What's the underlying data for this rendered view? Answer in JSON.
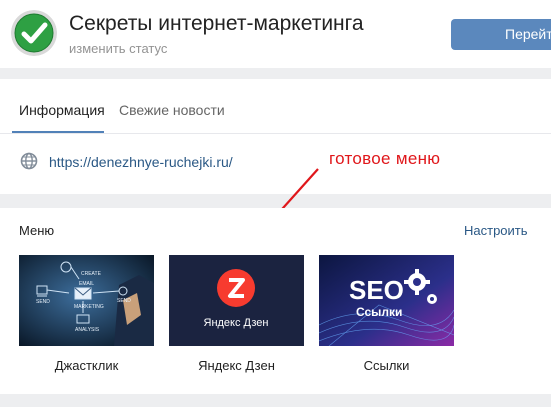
{
  "header": {
    "title": "Секреты интернет-маркетинга",
    "status": "изменить статус",
    "go_button": "Перейти"
  },
  "info": {
    "tabs": [
      {
        "label": "Информация",
        "active": true
      },
      {
        "label": "Свежие новости",
        "active": false
      }
    ],
    "site": "https://denezhnye-ruchejki.ru/",
    "annotation": "готовое меню"
  },
  "menu": {
    "title": "Меню",
    "configure": "Настроить",
    "items": [
      {
        "label": "Джастклик",
        "image_texts": [
          "CREATE",
          "EMAIL",
          "SEND",
          "MARKETING",
          "ANALYSIS"
        ]
      },
      {
        "label": "Яндекс Дзен",
        "image_texts": [
          "Яндекс Дзен"
        ]
      },
      {
        "label": "Ссылки",
        "image_texts": [
          "SEO",
          "Ссылки"
        ]
      }
    ]
  },
  "colors": {
    "accent": "#5181b8",
    "link": "#2a5885",
    "annotation": "#e0171b",
    "button": "#5b88bd",
    "zen_red": "#f73b2f"
  },
  "icons": [
    "checkmark-avatar-icon",
    "globe-icon",
    "red-arrow",
    "zen-logo-icon",
    "gear-icon"
  ]
}
